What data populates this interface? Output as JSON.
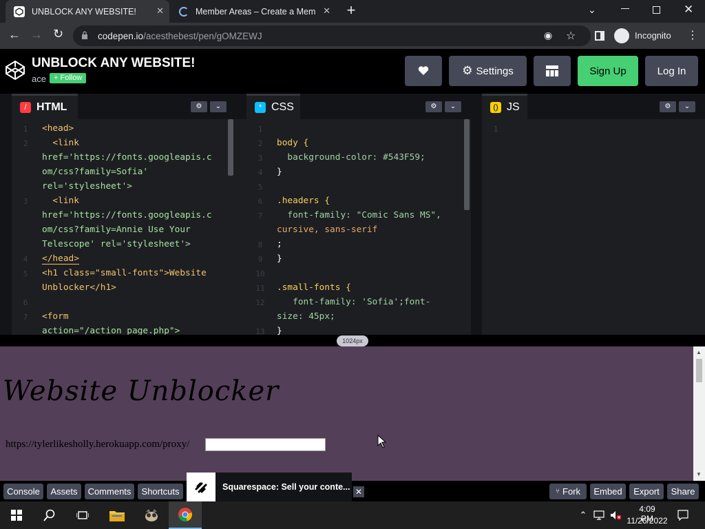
{
  "browser": {
    "tabs": [
      {
        "title": "UNBLOCK ANY WEBSITE!"
      },
      {
        "title": "Member Areas – Create a Membe"
      }
    ],
    "url_host": "codepen.io",
    "url_path": "/acesthebest/pen/gOMZEWJ",
    "incognito_label": "Incognito"
  },
  "codepen": {
    "title": "UNBLOCK ANY WEBSITE!",
    "author": "ace",
    "follow_label": "+ Follow",
    "settings_label": "Settings",
    "signup_label": "Sign Up",
    "login_label": "Log In",
    "editors": {
      "html": {
        "label": "HTML"
      },
      "css": {
        "label": "CSS"
      },
      "js": {
        "label": "JS"
      }
    },
    "html_lines": [
      {
        "num": "1",
        "code": "<head>"
      },
      {
        "num": "2",
        "code": "  <link"
      },
      {
        "num": "",
        "code": "href='https://fonts.googleapis.c"
      },
      {
        "num": "",
        "code": "om/css?family=Sofia'"
      },
      {
        "num": "",
        "code": "rel='stylesheet'>"
      },
      {
        "num": "3",
        "code": "  <link"
      },
      {
        "num": "",
        "code": "href='https://fonts.googleapis.c"
      },
      {
        "num": "",
        "code": "om/css?family=Annie Use Your"
      },
      {
        "num": "",
        "code": "Telescope' rel='stylesheet'>"
      },
      {
        "num": "4",
        "code": "</head>"
      },
      {
        "num": "5",
        "code": "<h1 class=\"small-fonts\">Website"
      },
      {
        "num": "",
        "code": "Unblocker</h1>"
      },
      {
        "num": "6",
        "code": ""
      },
      {
        "num": "7",
        "code": "<form"
      },
      {
        "num": "",
        "code": "action=\"/action_page.php\">"
      }
    ],
    "css_lines": [
      {
        "num": "1",
        "code": ""
      },
      {
        "num": "2",
        "code": "body {"
      },
      {
        "num": "3",
        "code": "  background-color: #543F59;"
      },
      {
        "num": "4",
        "code": "}"
      },
      {
        "num": "5",
        "code": ""
      },
      {
        "num": "6",
        "code": ".headers {"
      },
      {
        "num": "7",
        "code": "  font-family: \"Comic Sans MS\","
      },
      {
        "num": "",
        "code": "cursive, sans-serif"
      },
      {
        "num": "8",
        "code": ";"
      },
      {
        "num": "9",
        "code": "}"
      },
      {
        "num": "10",
        "code": ""
      },
      {
        "num": "11",
        "code": ".small-fonts {"
      },
      {
        "num": "12",
        "code": "   font-family: 'Sofia';font-"
      },
      {
        "num": "",
        "code": "size: 45px;"
      },
      {
        "num": "13",
        "code": "}"
      }
    ],
    "js_lines": [
      {
        "num": "1",
        "code": ""
      }
    ],
    "resize_label": "1024px",
    "preview": {
      "heading": "Website Unblocker",
      "proxy_text": "https://tylerlikesholly.herokuapp.com/proxy/",
      "input_value": ""
    },
    "footer": {
      "console": "Console",
      "assets": "Assets",
      "comments": "Comments",
      "shortcuts": "Shortcuts",
      "ad_text": "Squarespace: Sell your conte...",
      "fork": "Fork",
      "embed": "Embed",
      "export": "Export",
      "share": "Share"
    }
  },
  "taskbar": {
    "time": "4:09 PM",
    "date": "11/26/2022"
  },
  "colors": {
    "preview_bg": "#543F59",
    "signup_green": "#47cf73",
    "follow_green": "#47cf73"
  }
}
